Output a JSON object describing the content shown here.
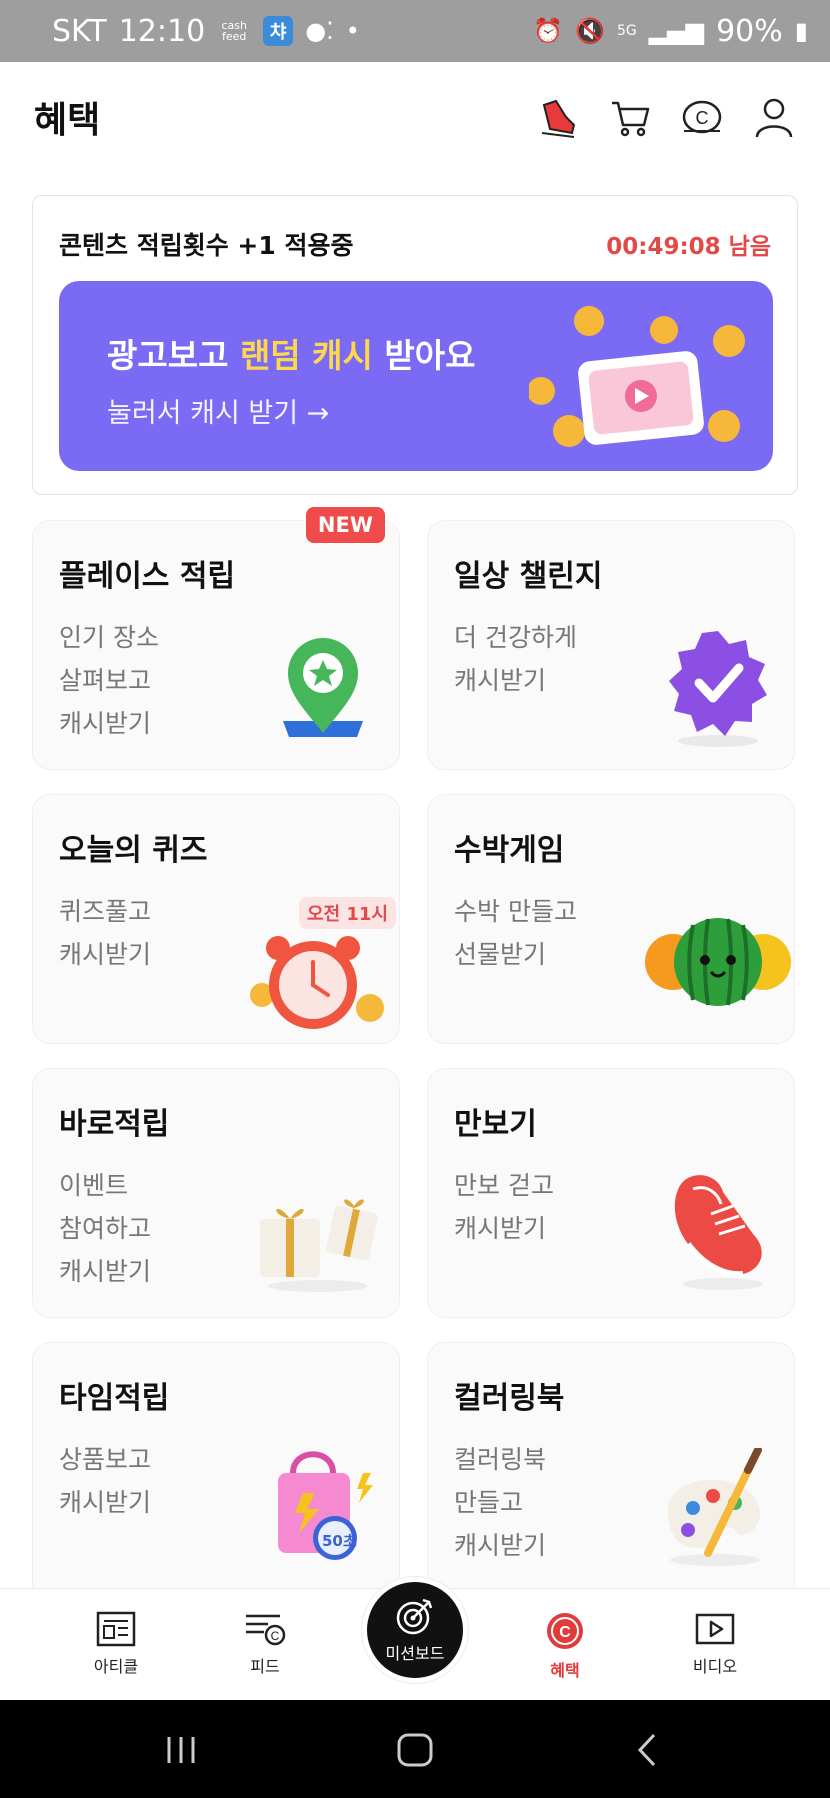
{
  "status_bar": {
    "carrier": "SKT",
    "time": "12:10",
    "cashfeed_badge": "cash feed",
    "cha_badge": "챠",
    "battery": "90%",
    "icons": [
      "alarm-icon",
      "mute-icon",
      "5g-icon",
      "signal-icon",
      "battery-icon"
    ]
  },
  "header": {
    "title": "혜택",
    "icons": [
      "shoe-icon",
      "cart-icon",
      "coin-icon",
      "profile-icon"
    ]
  },
  "boost": {
    "label": "콘텐츠 적립횟수 +1 적용중",
    "timer": "00:49:08 남음",
    "banner": {
      "title_pre": "광고보고 ",
      "title_highlight": "랜덤 캐시",
      "title_post": " 받아요",
      "subtitle": "눌러서 캐시 받기 →"
    }
  },
  "cards": [
    {
      "title": "플레이스 적립",
      "lines": [
        "인기 장소",
        "살펴보고",
        "캐시받기"
      ],
      "badge": "NEW",
      "icon": "map-pin-star-icon"
    },
    {
      "title": "일상 챌린지",
      "lines": [
        "더 건강하게",
        "캐시받기"
      ],
      "icon": "verified-badge-icon"
    },
    {
      "title": "오늘의 퀴즈",
      "lines": [
        "퀴즈풀고",
        "캐시받기"
      ],
      "time_badge": "오전 11시",
      "icon": "alarm-clock-icon"
    },
    {
      "title": "수박게임",
      "lines": [
        "수박 만들고",
        "선물받기"
      ],
      "icon": "watermelon-icon"
    },
    {
      "title": "바로적립",
      "lines": [
        "이벤트",
        "참여하고",
        "캐시받기"
      ],
      "icon": "gift-box-icon"
    },
    {
      "title": "만보기",
      "lines": [
        "만보 걷고",
        "캐시받기"
      ],
      "icon": "sneaker-icon"
    },
    {
      "title": "타임적립",
      "lines": [
        "상품보고",
        "캐시받기"
      ],
      "timer_badge": "50초",
      "icon": "shopping-bag-icon"
    },
    {
      "title": "컬러링북",
      "lines": [
        "컬러링북",
        "만들고",
        "캐시받기"
      ],
      "icon": "paint-palette-icon"
    }
  ],
  "bottom_nav": {
    "items": [
      {
        "label": "아티클",
        "icon": "article-icon"
      },
      {
        "label": "피드",
        "icon": "feed-icon"
      },
      {
        "label": "미션보드",
        "icon": "target-icon"
      },
      {
        "label": "혜택",
        "icon": "benefit-coin-icon",
        "active": true
      },
      {
        "label": "비디오",
        "icon": "video-icon"
      }
    ]
  },
  "colors": {
    "accent": "#e23b3b",
    "banner": "#7b6af4",
    "highlight": "#ffd84a",
    "timer": "#e24a4a"
  }
}
